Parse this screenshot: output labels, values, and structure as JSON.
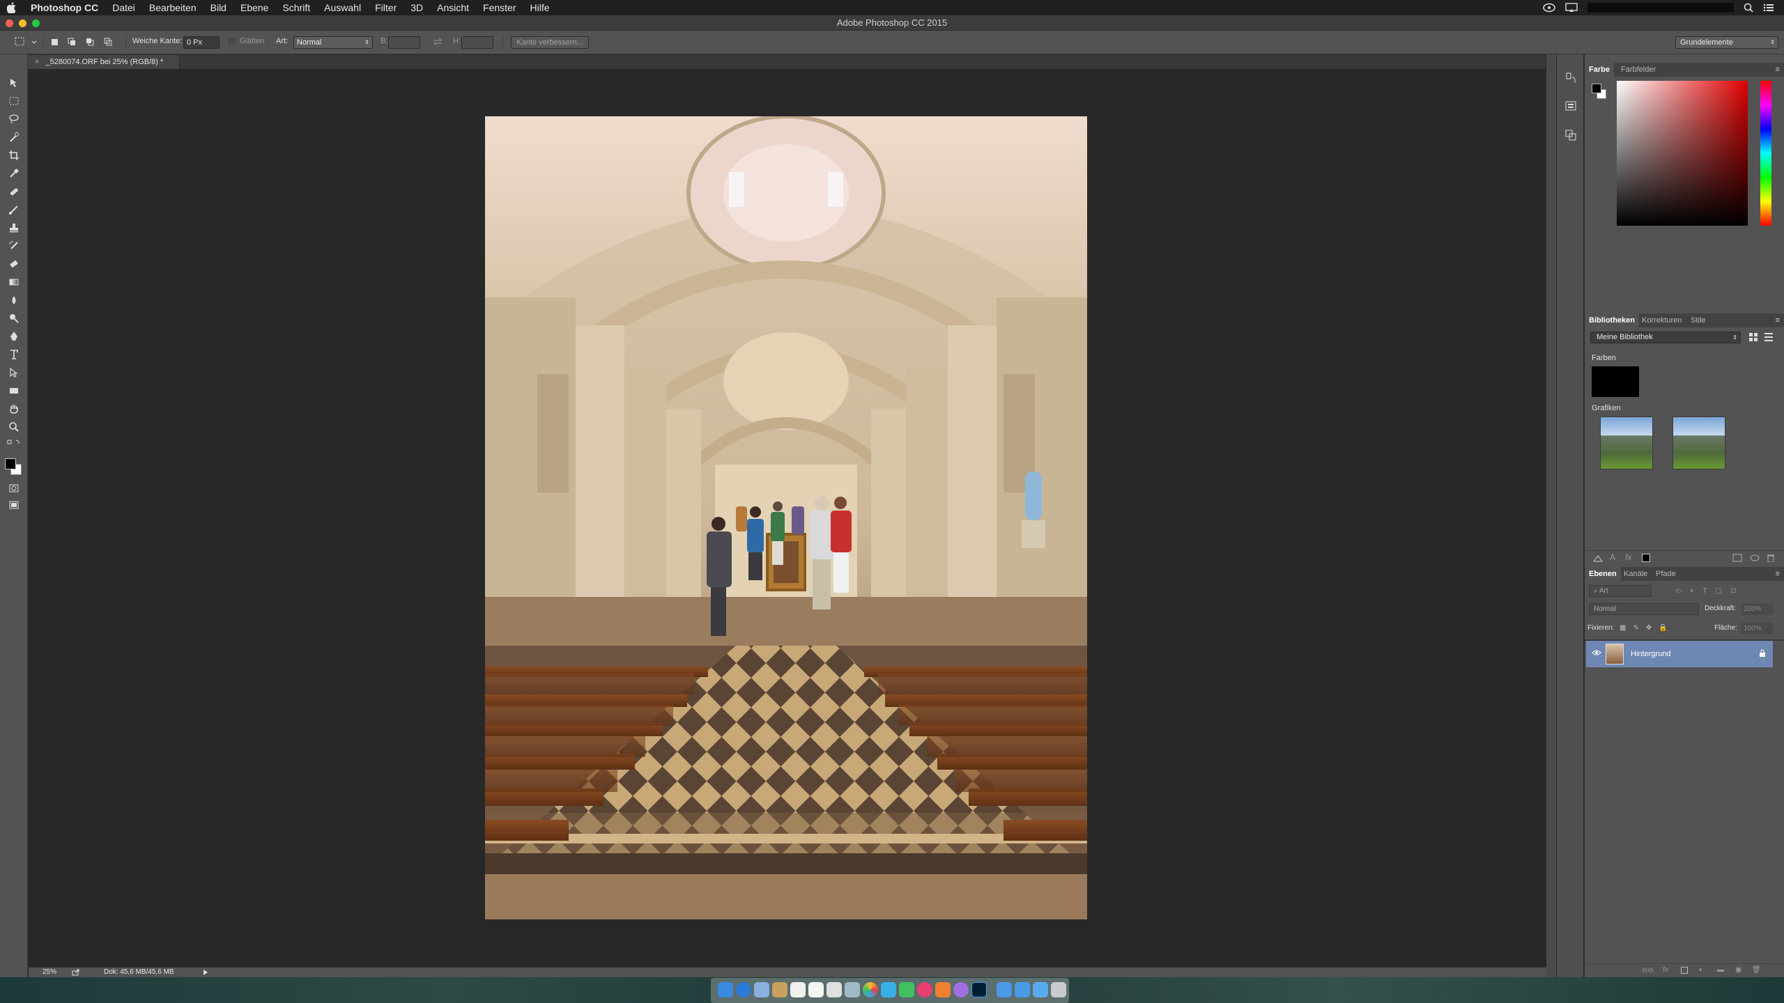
{
  "menubar": {
    "apple": "",
    "app": "Photoshop CC",
    "items": [
      "Datei",
      "Bearbeiten",
      "Bild",
      "Ebene",
      "Schrift",
      "Auswahl",
      "Filter",
      "3D",
      "Ansicht",
      "Fenster",
      "Hilfe"
    ]
  },
  "window": {
    "title": "Adobe Photoshop CC 2015"
  },
  "options": {
    "feather_label": "Weiche Kante:",
    "feather_value": "0 Px",
    "smooth_label": "Glätten",
    "style_label": "Art:",
    "style_value": "Normal",
    "width_label": "B:",
    "height_label": "H:",
    "refine_label": "Kante verbessern...",
    "workspace": "Grundelemente"
  },
  "document": {
    "tab": "_5280074.ORF bei 25% (RGB/8) *",
    "close": "×"
  },
  "status": {
    "zoom": "25%",
    "doc": "Dok: 45,6 MB/45,6 MB"
  },
  "color_panel": {
    "tabs": [
      "Farbe",
      "Farbfelder"
    ]
  },
  "libraries": {
    "tabs": [
      "Bibliotheken",
      "Korrekturen",
      "Stile"
    ],
    "library": "Meine Bibliothek",
    "colors_label": "Farben",
    "graphics_label": "Grafiken"
  },
  "layers": {
    "tabs": [
      "Ebenen",
      "Kanäle",
      "Pfade"
    ],
    "filter": "Art",
    "blend": "Normal",
    "opacity_label": "Deckkraft:",
    "opacity": "100%",
    "lock_label": "Fixieren:",
    "fill_label": "Fläche:",
    "fill": "100%",
    "layer_name": "Hintergrund"
  },
  "colors": {
    "accent": "#6f87b3",
    "foreground": "#000000",
    "background": "#ffffff"
  }
}
